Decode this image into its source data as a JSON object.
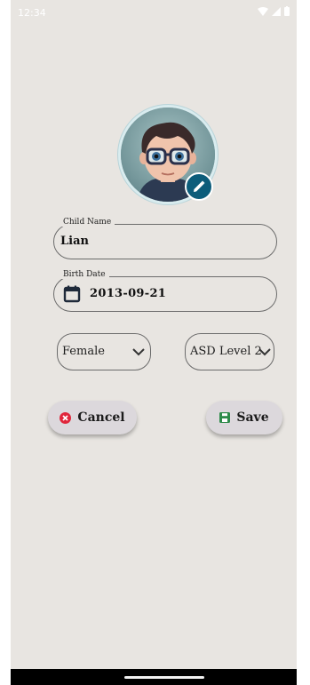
{
  "status_bar": {
    "time": "12:34"
  },
  "profile": {
    "avatar_icon": "child-avatar",
    "edit_icon": "pencil-icon"
  },
  "child_name": {
    "label": "Child Name",
    "value": "Lian"
  },
  "birth_date": {
    "label": "Birth Date",
    "value": "2013-09-21",
    "icon": "calendar-icon"
  },
  "gender": {
    "value": "Female"
  },
  "asd_level": {
    "value": "ASD Level 2"
  },
  "actions": {
    "cancel_label": "Cancel",
    "save_label": "Save",
    "cancel_color": "#e0263b",
    "save_color": "#2e8b4a"
  }
}
